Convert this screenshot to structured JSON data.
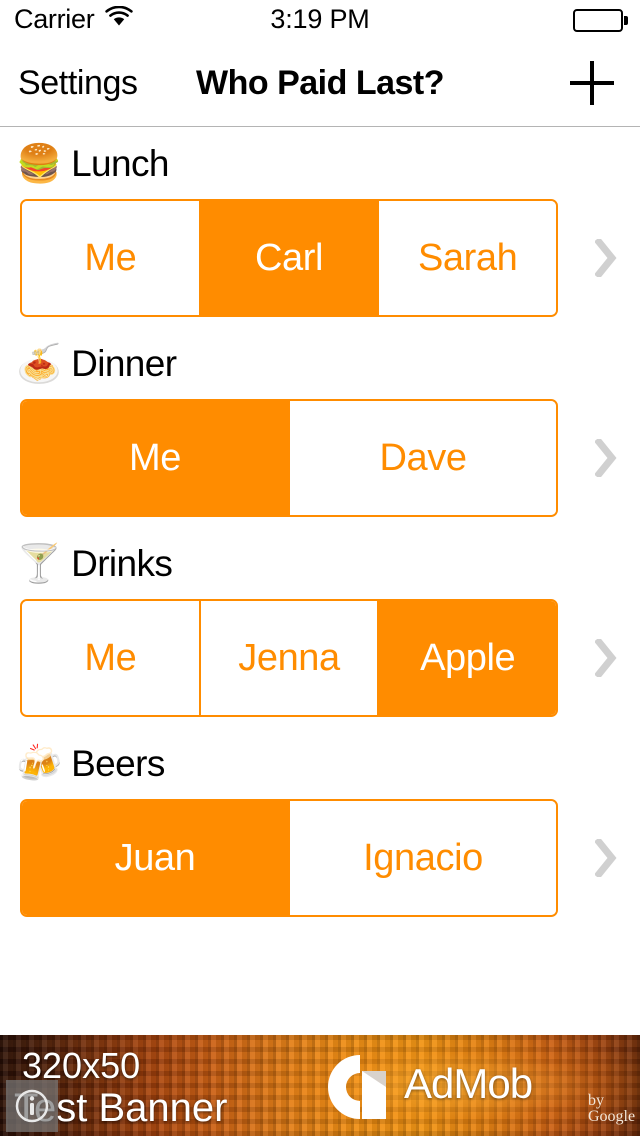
{
  "status_bar": {
    "carrier": "Carrier",
    "wifi_icon": "wifi-icon",
    "time": "3:19 PM",
    "battery_icon": "battery-full-icon"
  },
  "nav_bar": {
    "back_label": "Settings",
    "title": "Who Paid Last?",
    "add_icon": "plus-icon"
  },
  "colors": {
    "accent": "#FF8C00",
    "text": "#000000",
    "chevron": "#D0D0D0",
    "separator": "#B4B4B4"
  },
  "groups": [
    {
      "emoji": "🍔",
      "icon_name": "hamburger-emoji",
      "label": "Lunch",
      "chevron_icon": "chevron-right-icon",
      "segments": [
        {
          "label": "Me",
          "selected": false
        },
        {
          "label": "Carl",
          "selected": true
        },
        {
          "label": "Sarah",
          "selected": false
        }
      ]
    },
    {
      "emoji": "🍝",
      "icon_name": "spaghetti-emoji",
      "label": "Dinner",
      "chevron_icon": "chevron-right-icon",
      "segments": [
        {
          "label": "Me",
          "selected": true
        },
        {
          "label": "Dave",
          "selected": false
        }
      ]
    },
    {
      "emoji": "🍸",
      "icon_name": "cocktail-glass-emoji",
      "label": "Drinks",
      "chevron_icon": "chevron-right-icon",
      "segments": [
        {
          "label": "Me",
          "selected": false
        },
        {
          "label": "Jenna",
          "selected": false
        },
        {
          "label": "Apple",
          "selected": true
        }
      ]
    },
    {
      "emoji": "🍻",
      "icon_name": "clinking-beer-mugs-emoji",
      "label": "Beers",
      "chevron_icon": "chevron-right-icon",
      "segments": [
        {
          "label": "Juan",
          "selected": true
        },
        {
          "label": "Ignacio",
          "selected": false
        }
      ]
    }
  ],
  "ad_banner": {
    "size_text": "320x50",
    "subtitle": "Test Banner",
    "brand": "AdMob",
    "by_line": "by Google",
    "logo_icon": "admob-logo-icon",
    "info_icon": "info-circle-icon"
  }
}
